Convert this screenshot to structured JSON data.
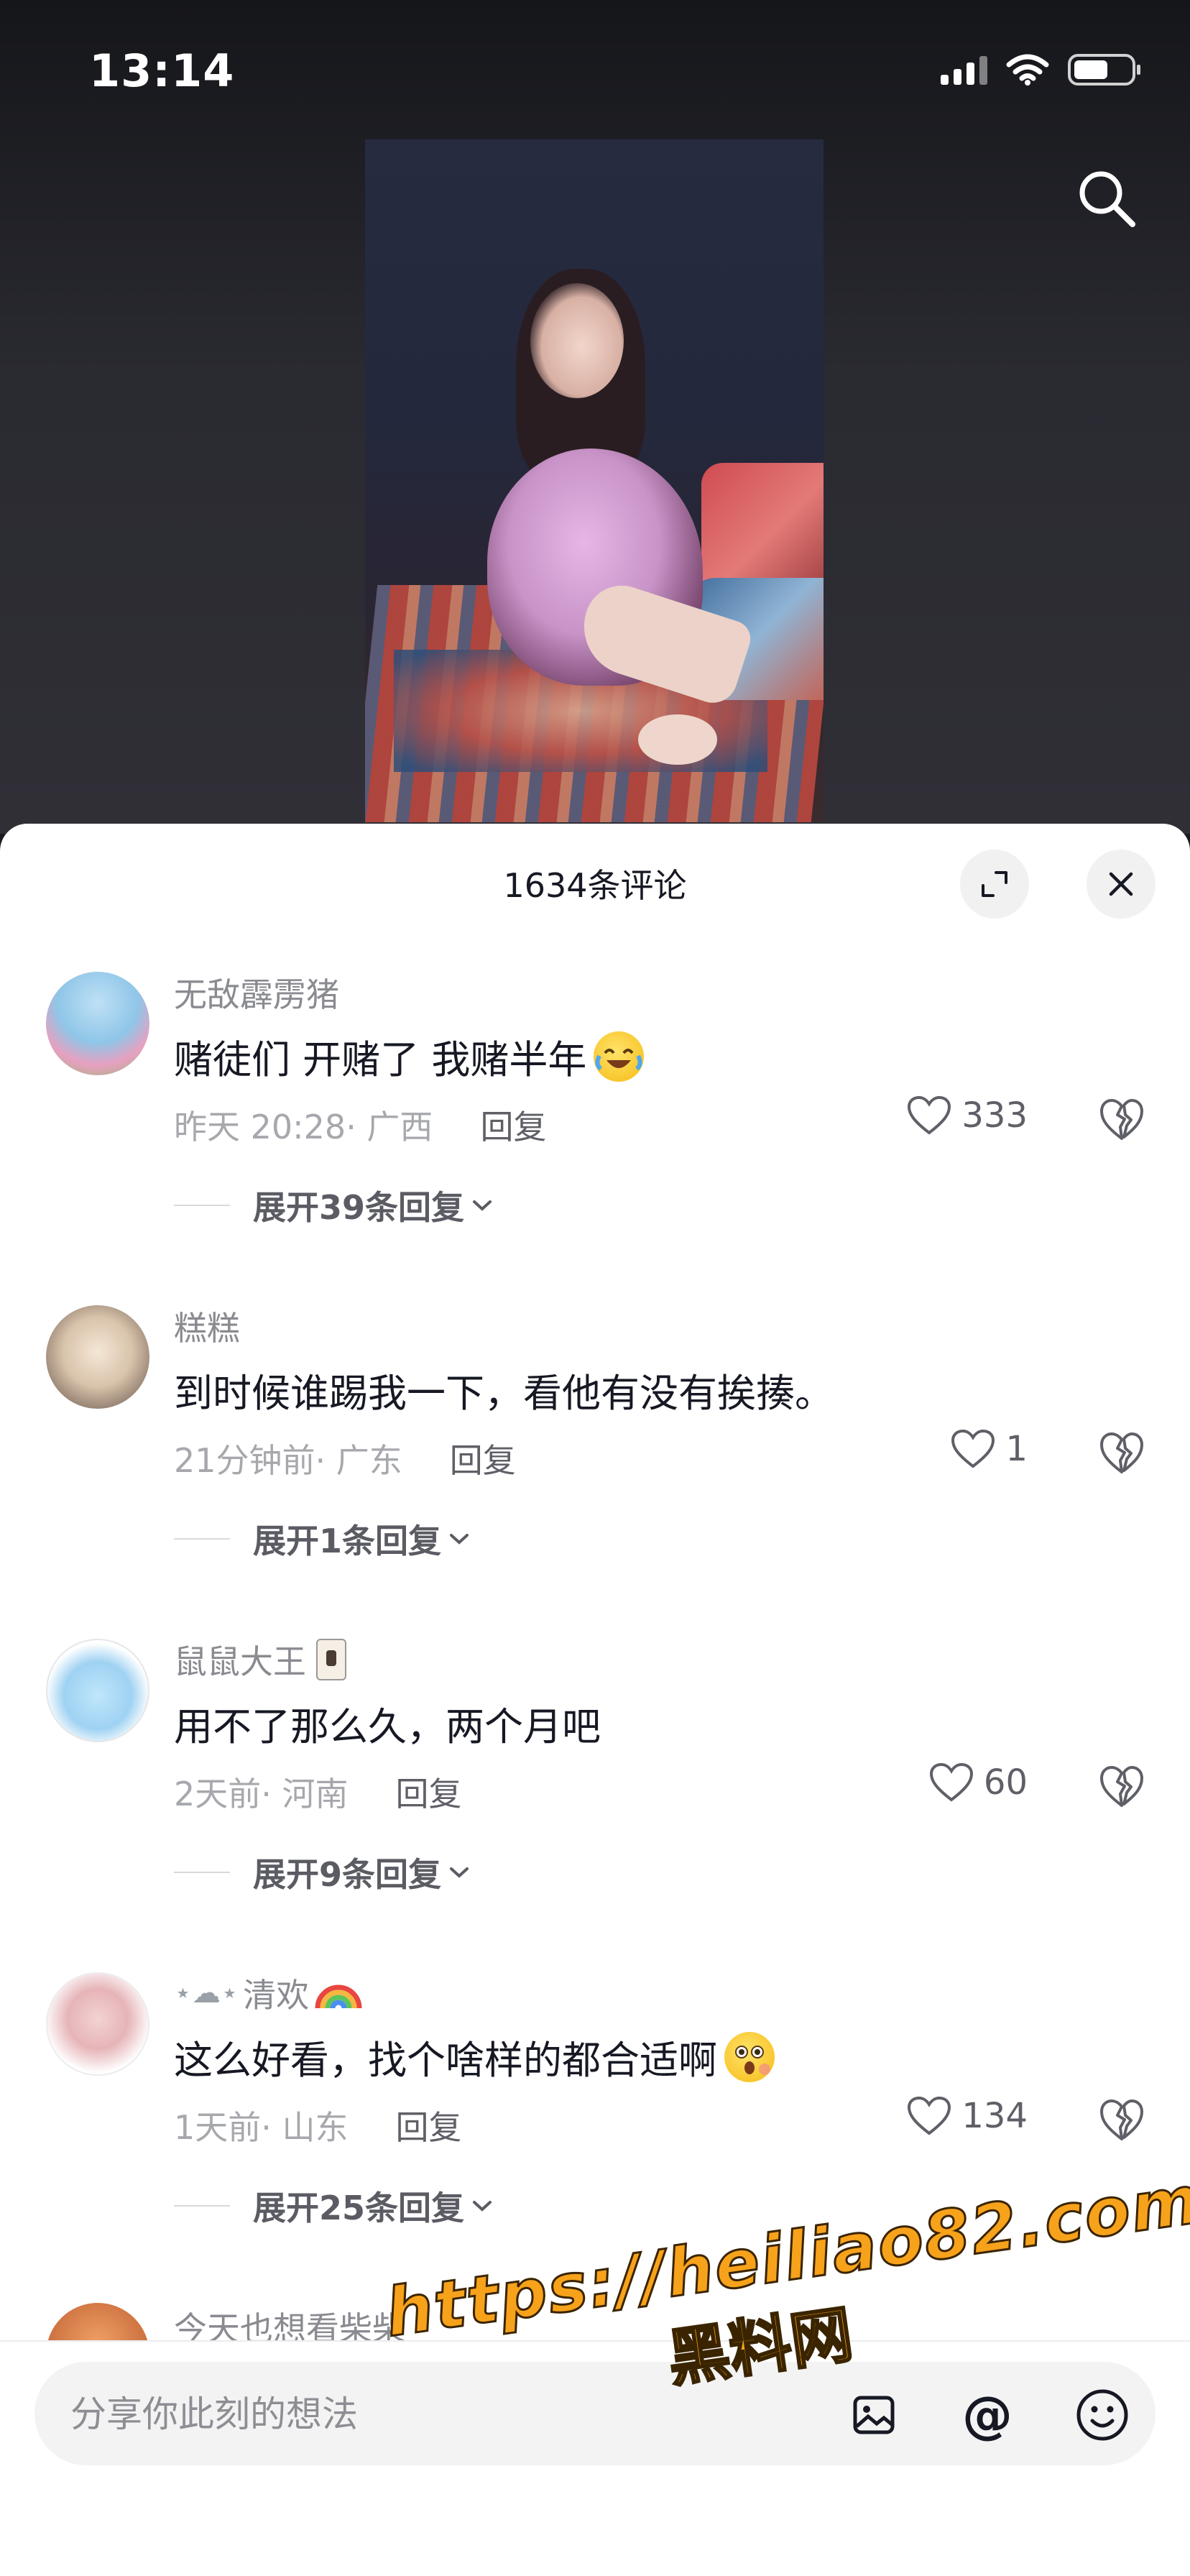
{
  "status_bar": {
    "time": "13:14"
  },
  "comments_sheet": {
    "title": "1634条评论",
    "comments": [
      {
        "username": "无敌霹雳猪",
        "text": "赌徒们 开赌了   我赌半年",
        "time": "昨天 20:28",
        "location": "· 广西",
        "reply_label": "回复",
        "likes": "333",
        "expand_label": "展开39条回复"
      },
      {
        "username": "糕糕",
        "text": "到时候谁踢我一下，看他有没有挨揍。",
        "time": "21分钟前",
        "location": " · 广东",
        "reply_label": "回复",
        "likes": "1",
        "expand_label": "展开1条回复"
      },
      {
        "username": "鼠鼠大王",
        "text": "用不了那么久，两个月吧",
        "time": "2天前",
        "location": " · 河南",
        "reply_label": "回复",
        "likes": "60",
        "expand_label": "展开9条回复"
      },
      {
        "username": "清欢",
        "text": "这么好看，找个啥样的都合适啊",
        "time": "1天前",
        "location": " · 山东",
        "reply_label": "回复",
        "likes": "134",
        "expand_label": "展开25条回复"
      }
    ],
    "peek_username": "今天也想看柴柴"
  },
  "composer": {
    "placeholder": "分享你此刻的想法"
  },
  "watermark": {
    "url": "https://heiliao82.com",
    "name": "黑料网"
  },
  "colors": {
    "text_primary": "#161823",
    "text_secondary": "#8a8b91",
    "watermark": "#f7a21b"
  },
  "icons": [
    "search-icon",
    "expand-icon",
    "close-icon",
    "heart-icon",
    "broken-heart-icon",
    "chevron-down-icon",
    "image-icon",
    "at-icon",
    "emoji-icon"
  ]
}
